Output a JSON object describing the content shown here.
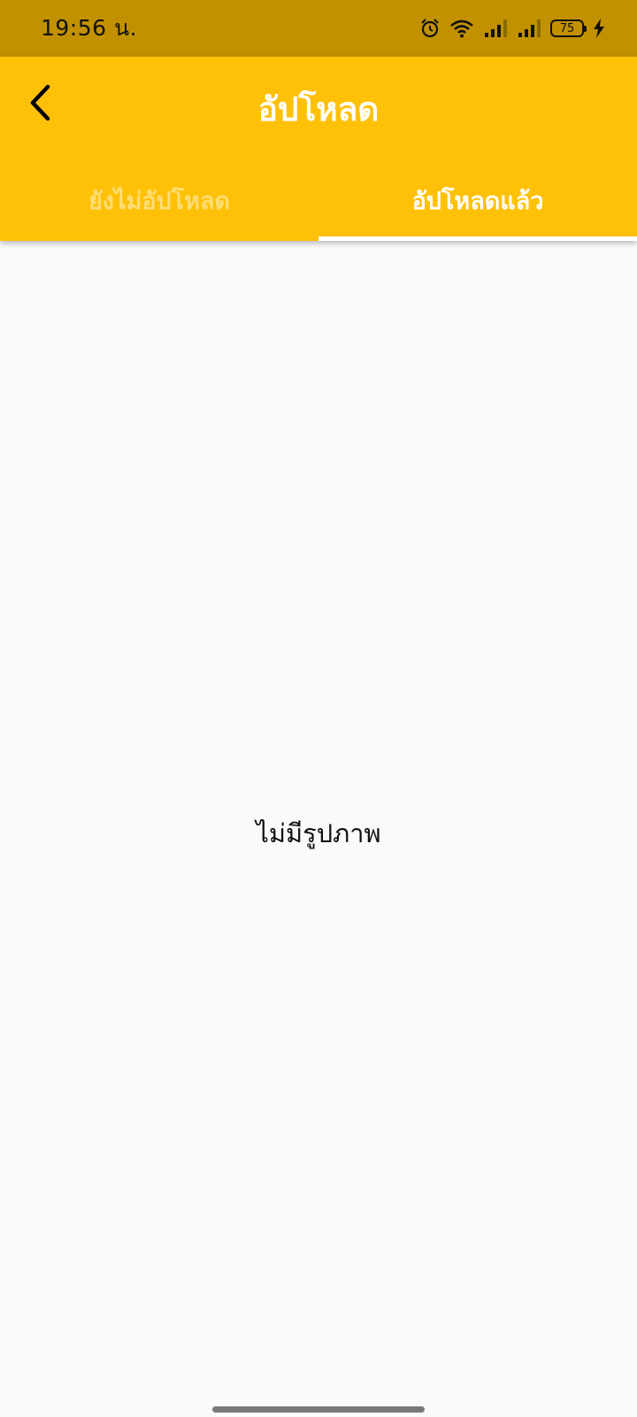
{
  "status_bar": {
    "time": "19:56 น.",
    "battery_level": "75",
    "icons": [
      "alarm-icon",
      "wifi-icon",
      "signal-icon",
      "signal-icon",
      "battery-icon",
      "charging-icon"
    ]
  },
  "header": {
    "title": "อัปโหลด",
    "back_icon": "chevron-left-icon"
  },
  "tabs": [
    {
      "label": "ยังไม่อัปโหลด",
      "active": false
    },
    {
      "label": "อัปโหลดแล้ว",
      "active": true
    }
  ],
  "main": {
    "empty_message": "ไม่มีรูปภาพ"
  },
  "colors": {
    "status_bar": "#c29100",
    "app_bar": "#ffc107",
    "background": "#fafafa"
  }
}
